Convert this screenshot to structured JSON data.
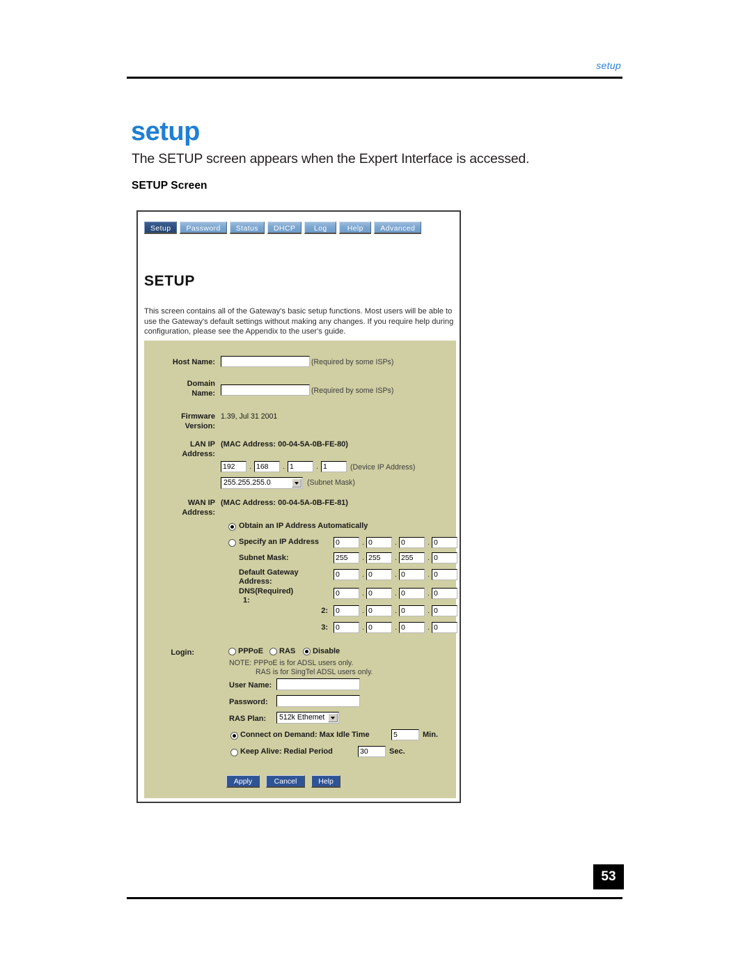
{
  "page": {
    "header_label": "setup",
    "title": "setup",
    "intro": "The SETUP screen appears when the Expert Interface is accessed.",
    "section_title": "SETUP Screen",
    "page_number": "53"
  },
  "screenshot": {
    "tabs": [
      {
        "label": "Setup",
        "active": true
      },
      {
        "label": "Password",
        "active": false
      },
      {
        "label": "Status",
        "active": false
      },
      {
        "label": "DHCP",
        "active": false
      },
      {
        "label": "Log",
        "active": false
      },
      {
        "label": "Help",
        "active": false
      },
      {
        "label": "Advanced",
        "active": false
      }
    ],
    "heading": "SETUP",
    "description": "This screen contains all of the Gateway's basic setup functions. Most users will be able to use the Gateway's default settings without making any changes. If you require help during configuration, please see the Appendix to the user's guide.",
    "form": {
      "host_name": {
        "label": "Host Name:",
        "value": "",
        "hint": "(Required by some ISPs)"
      },
      "domain_name": {
        "label_line1": "Domain",
        "label_line2": "Name:",
        "value": "",
        "hint": "(Required by some ISPs)"
      },
      "firmware": {
        "label_line1": "Firmware",
        "label_line2": "Version:",
        "value": "1.39, Jul 31 2001"
      },
      "lan_ip": {
        "label_line1": "LAN IP",
        "label_line2": "Address:",
        "mac": "(MAC Address: 00-04-5A-0B-FE-80)",
        "octets": [
          "192",
          "168",
          "1",
          "1"
        ],
        "device_hint": "(Device IP Address)",
        "subnet_mask_value": "255.255.255.0",
        "subnet_mask_hint": "(Subnet Mask)"
      },
      "wan_ip": {
        "label_line1": "WAN IP",
        "label_line2": "Address:",
        "mac": "(MAC Address: 00-04-5A-0B-FE-81)",
        "obtain_auto_label": "Obtain an IP Address Automatically",
        "obtain_auto_selected": true,
        "specify_label": "Specify an IP Address",
        "specify_selected": false,
        "specify_octets": [
          "0",
          "0",
          "0",
          "0"
        ],
        "subnet_mask_label": "Subnet Mask:",
        "subnet_mask_octets": [
          "255",
          "255",
          "255",
          "0"
        ],
        "gateway_label_line1": "Default Gateway",
        "gateway_label_line2": "Address:",
        "gateway_octets": [
          "0",
          "0",
          "0",
          "0"
        ],
        "dns1_label_line1": "DNS(Required)",
        "dns1_label_line2": "1:",
        "dns1_octets": [
          "0",
          "0",
          "0",
          "0"
        ],
        "dns2_label": "2:",
        "dns2_octets": [
          "0",
          "0",
          "0",
          "0"
        ],
        "dns3_label": "3:",
        "dns3_octets": [
          "0",
          "0",
          "0",
          "0"
        ]
      },
      "login": {
        "label": "Login:",
        "options": [
          {
            "label": "PPPoE",
            "selected": false
          },
          {
            "label": "RAS",
            "selected": false
          },
          {
            "label": "Disable",
            "selected": true
          }
        ],
        "note_line1": "NOTE: PPPoE is for ADSL users only.",
        "note_line2": "RAS is for SingTel ADSL users only.",
        "user_name_label": "User Name:",
        "user_name_value": "",
        "password_label": "Password:",
        "password_value": "",
        "ras_plan_label": "RAS Plan:",
        "ras_plan_value": "512k Ethemet",
        "connect_on_demand_label": "Connect on Demand: Max Idle Time",
        "connect_on_demand_selected": true,
        "max_idle_time": "5",
        "max_idle_unit": "Min.",
        "keep_alive_label": "Keep Alive: Redial Period",
        "keep_alive_selected": false,
        "redial_period": "30",
        "redial_unit": "Sec."
      },
      "buttons": [
        {
          "label": "Apply"
        },
        {
          "label": "Cancel"
        },
        {
          "label": "Help"
        }
      ]
    }
  }
}
